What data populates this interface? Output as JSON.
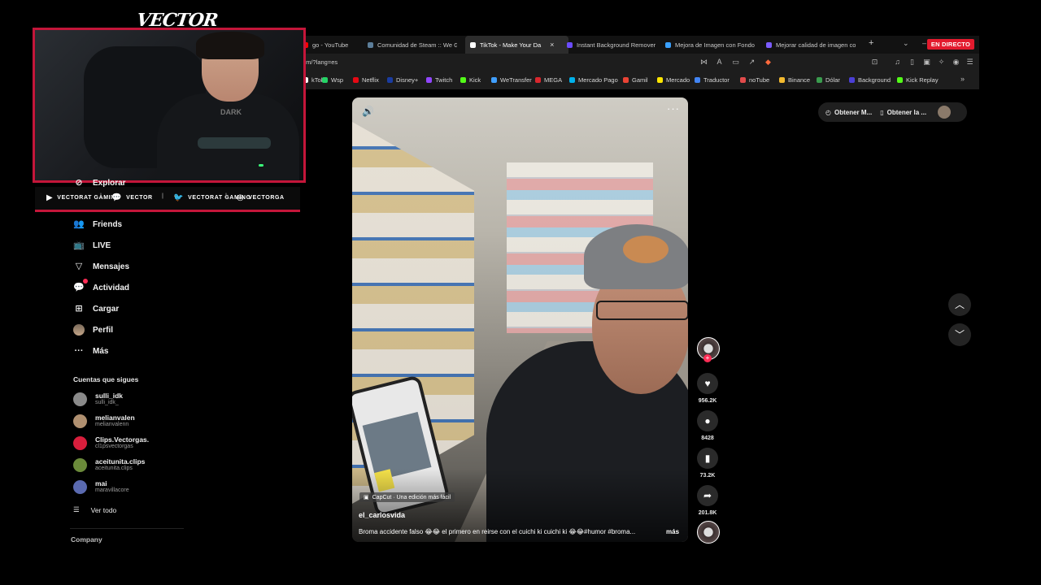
{
  "browser": {
    "tabs": [
      {
        "label": "go - YouTube",
        "color": "#ff0000"
      },
      {
        "label": "Comunidad de Steam :: We G",
        "color": "#5c7e9a"
      },
      {
        "label": "TikTok - Make Your Da",
        "color": "#ffffff",
        "active": true
      },
      {
        "label": "Instant Background Remover",
        "color": "#6b4cff"
      },
      {
        "label": "Mejora de Imagen con Fondo",
        "color": "#3aa0ff"
      },
      {
        "label": "Mejorar calidad de imagen co",
        "color": "#7b5cff"
      }
    ],
    "live_badge": "EN DIRECTO",
    "url": "om/?lang=es",
    "bookmarks": [
      {
        "label": "kTok",
        "color": "#ffffff"
      },
      {
        "label": "Wsp",
        "color": "#25d366"
      },
      {
        "label": "Netflix",
        "color": "#e50914"
      },
      {
        "label": "Disney+",
        "color": "#1a3ca0"
      },
      {
        "label": "Twitch",
        "color": "#9146ff"
      },
      {
        "label": "Kick",
        "color": "#53fc18"
      },
      {
        "label": "WeTransfer",
        "color": "#409fff"
      },
      {
        "label": "MEGA",
        "color": "#d9272e"
      },
      {
        "label": "Mercado Pago",
        "color": "#00b1ea"
      },
      {
        "label": "Gamil",
        "color": "#ea4335"
      },
      {
        "label": "Mercado",
        "color": "#ffe600"
      },
      {
        "label": "Traductor",
        "color": "#4285f4"
      },
      {
        "label": "noTube",
        "color": "#e24b4b"
      },
      {
        "label": "Binance",
        "color": "#f3ba2f"
      },
      {
        "label": "Dólar",
        "color": "#3a9c4e"
      },
      {
        "label": "Background",
        "color": "#4b3fd6"
      },
      {
        "label": "Kick Replay",
        "color": "#53fc18"
      }
    ]
  },
  "stream": {
    "logo": "VECTOR",
    "cam_shirt": "DARK",
    "socials": [
      {
        "icon": "youtube-icon",
        "glyph": "▶",
        "text": "VECTORAT GAMING"
      },
      {
        "icon": "twitch-icon",
        "glyph": "💬",
        "text": "VECTOR"
      },
      {
        "icon": "twitter-icon",
        "glyph": "🐦",
        "text": "VECTORAT GAMING"
      },
      {
        "icon": "instagram-icon",
        "glyph": "◎",
        "text": "VECTORGA"
      }
    ]
  },
  "sidebar": {
    "explore": "Explorar",
    "items": [
      {
        "label": "Friends",
        "icon": "friends-icon",
        "glyph": "👥"
      },
      {
        "label": "LIVE",
        "icon": "live-icon",
        "glyph": "📺"
      },
      {
        "label": "Mensajes",
        "icon": "messages-icon",
        "glyph": "▽"
      },
      {
        "label": "Actividad",
        "icon": "activity-icon",
        "glyph": "💬",
        "badge": true
      },
      {
        "label": "Cargar",
        "icon": "upload-icon",
        "glyph": "⊞"
      },
      {
        "label": "Perfil",
        "icon": "profile-avatar",
        "glyph": ""
      },
      {
        "label": "Más",
        "icon": "more-icon",
        "glyph": "···"
      }
    ],
    "following_title": "Cuentas que sigues",
    "accounts": [
      {
        "name": "sulli_idk",
        "handle": "sulli_idk_",
        "color": "#8a8a8a"
      },
      {
        "name": "melianvalen",
        "handle": "melianvalenn",
        "color": "#b09070"
      },
      {
        "name": "Clips.Vectorgas.",
        "handle": "cl1psvectorgas",
        "color": "#d81e3c"
      },
      {
        "name": "aceitunita.clips",
        "handle": "aceitunita.clips",
        "color": "#6b8a3a"
      },
      {
        "name": "mai",
        "handle": "maravillacore",
        "color": "#5a6ab0"
      }
    ],
    "see_all": "Ver todo",
    "company": "Company"
  },
  "video": {
    "capcut": "CapCut · Una edición más fácil",
    "username": "el_carlosvida",
    "description": "Broma accidente falso 😂😂 el primero en reirse con el cuichi ki cuichi ki 😂😂#humor #broma...",
    "more": "más",
    "counts": {
      "likes": "956.2K",
      "comments": "8428",
      "saves": "73.2K",
      "shares": "201.8K"
    }
  },
  "right": {
    "get_app": "Obtener M...",
    "get_app2": "Obtener la ..."
  }
}
